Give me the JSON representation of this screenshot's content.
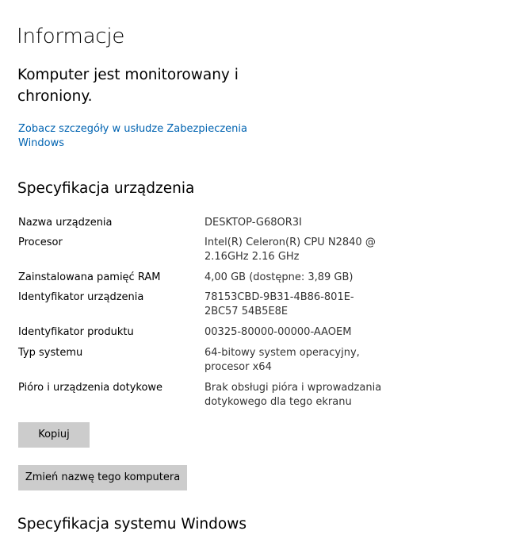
{
  "header": {
    "title": "Informacje"
  },
  "protection": {
    "status": "Komputer jest monitorowany i chroniony.",
    "link": "Zobacz szczegóły w usłudze Zabezpieczenia Windows"
  },
  "device_specs": {
    "title": "Specyfikacja urządzenia",
    "rows": [
      {
        "label": "Nazwa urządzenia",
        "value": "DESKTOP-G68OR3I"
      },
      {
        "label": "Procesor",
        "value": "Intel(R) Celeron(R) CPU  N2840  @ 2.16GHz   2.16 GHz"
      },
      {
        "label": "Zainstalowana pamięć RAM",
        "value": "4,00 GB (dostępne: 3,89 GB)"
      },
      {
        "label": "Identyfikator urządzenia",
        "value": "78153CBD-9B31-4B86-801E-2BC57 54B5E8E"
      },
      {
        "label": "Identyfikator produktu",
        "value": "00325-80000-00000-AAOEM"
      },
      {
        "label": "Typ systemu",
        "value": "64-bitowy system operacyjny, procesor x64"
      },
      {
        "label": "Pióro i urządzenia dotykowe",
        "value": "Brak obsługi pióra i wprowadzania dotykowego dla tego ekranu"
      }
    ]
  },
  "buttons": {
    "copy": "Kopiuj",
    "rename": "Zmień nazwę tego komputera"
  },
  "windows_specs": {
    "title": "Specyfikacja systemu Windows"
  },
  "colors": {
    "link": "#0063b1",
    "button_bg": "#cccccc",
    "value_text": "#333333"
  }
}
